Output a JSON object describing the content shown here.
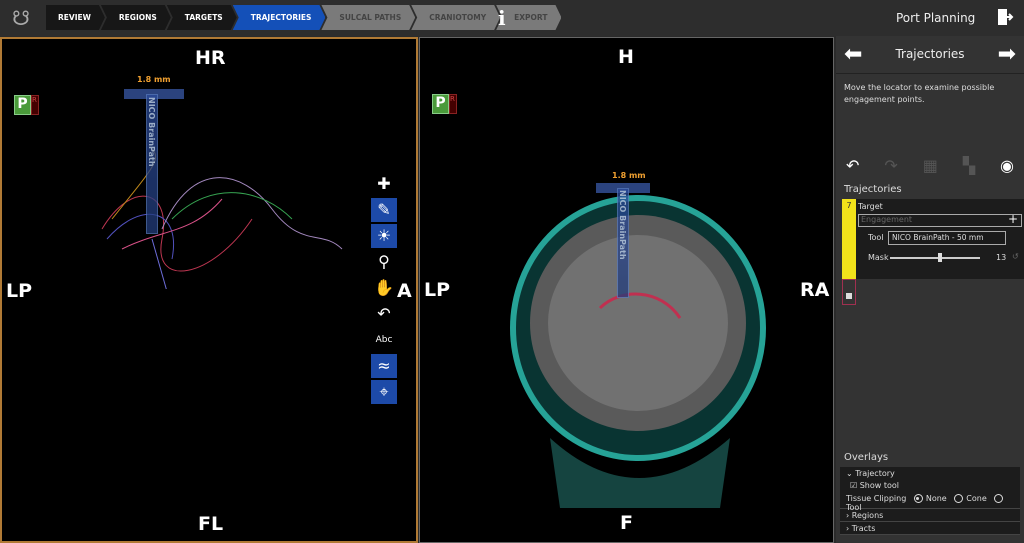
{
  "header": {
    "steps": [
      {
        "label": "REVIEW",
        "state": "done"
      },
      {
        "label": "REGIONS",
        "state": "done"
      },
      {
        "label": "TARGETS",
        "state": "done"
      },
      {
        "label": "TRAJECTORIES",
        "state": "active"
      },
      {
        "label": "SULCAL PATHS",
        "state": "disabled"
      },
      {
        "label": "CRANIOTOMY",
        "state": "disabled"
      },
      {
        "label": "EXPORT",
        "state": "disabled"
      }
    ],
    "info_icon": "i",
    "title": "Port Planning",
    "accent": "#1450b8"
  },
  "viewports": {
    "left": {
      "top": "HR",
      "bottom": "FL",
      "left": "LP",
      "right": "A",
      "p_label": "P",
      "r_label": "R",
      "tool_size": "1.8 mm",
      "tool_name": "NICO BrainPath"
    },
    "right": {
      "top": "H",
      "bottom": "F",
      "left": "LP",
      "right": "RA",
      "p_label": "P",
      "r_label": "R",
      "tool_size": "1.8 mm",
      "tool_name": "NICO BrainPath"
    }
  },
  "toolbar": [
    "crosshair-icon",
    "locator-icon",
    "brightness-icon",
    "zoom-icon",
    "pan-icon",
    "undo-icon",
    "labels-icon",
    "tracts-icon",
    "target-icon"
  ],
  "sidebar": {
    "title": "Trajectories",
    "instructions": "Move the locator to examine possible engagement points.",
    "section": "Trajectories",
    "trajectory": {
      "index": "7",
      "target": "Target",
      "engagement": "Engagement",
      "tool_label": "Tool",
      "tool_value": "NICO BrainPath - 50 mm",
      "mask_label": "Mask",
      "mask_value": "13",
      "color": "#f2e21a"
    },
    "overlays": {
      "title": "Overlays",
      "trajectory": "Trajectory",
      "show_tool": "Show tool",
      "show_tool_checked": true,
      "tissue_clipping": "Tissue Clipping",
      "options": [
        "None",
        "Cone",
        "Tool"
      ],
      "selected": "None",
      "regions": "Regions",
      "tracts": "Tracts"
    }
  }
}
